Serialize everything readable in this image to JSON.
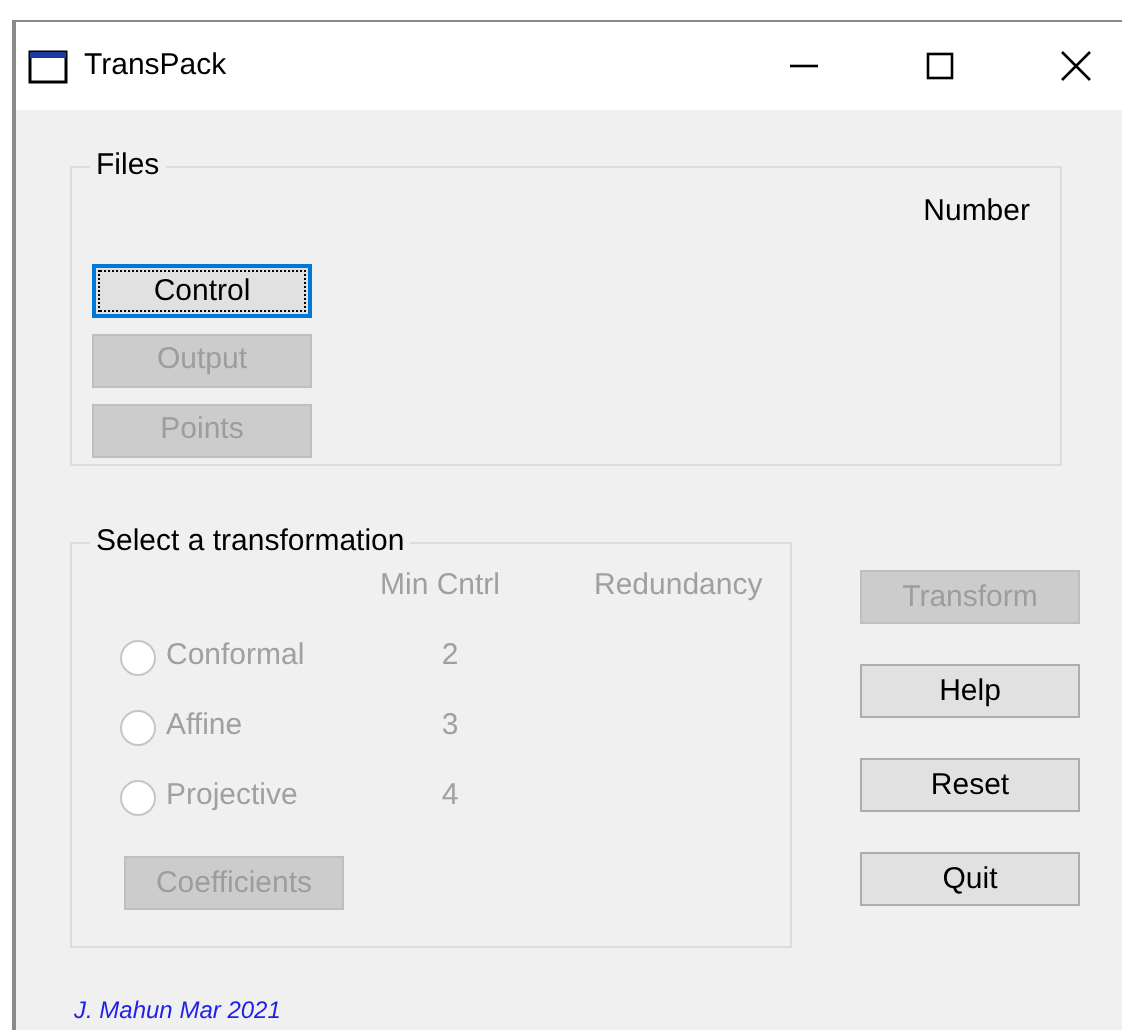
{
  "window": {
    "title": "TransPack"
  },
  "files": {
    "title": "Files",
    "number_label": "Number",
    "buttons": [
      {
        "label": "Control",
        "disabled": false,
        "focused": true
      },
      {
        "label": "Output",
        "disabled": true,
        "focused": false
      },
      {
        "label": "Points",
        "disabled": true,
        "focused": false
      }
    ]
  },
  "transformation": {
    "title": "Select a transformation",
    "disabled": true,
    "columns": [
      "Min Cntrl",
      "Redundancy"
    ],
    "options": [
      {
        "label": "Conformal",
        "min_control": "2",
        "selected": false
      },
      {
        "label": "Affine",
        "min_control": "3",
        "selected": false
      },
      {
        "label": "Projective",
        "min_control": "4",
        "selected": false
      }
    ],
    "coefficients_button": {
      "label": "Coefficients",
      "disabled": true
    }
  },
  "actions": [
    {
      "label": "Transform",
      "disabled": true
    },
    {
      "label": "Help",
      "disabled": false
    },
    {
      "label": "Reset",
      "disabled": false
    },
    {
      "label": "Quit",
      "disabled": false
    }
  ],
  "footer": "J. Mahun Mar 2021"
}
